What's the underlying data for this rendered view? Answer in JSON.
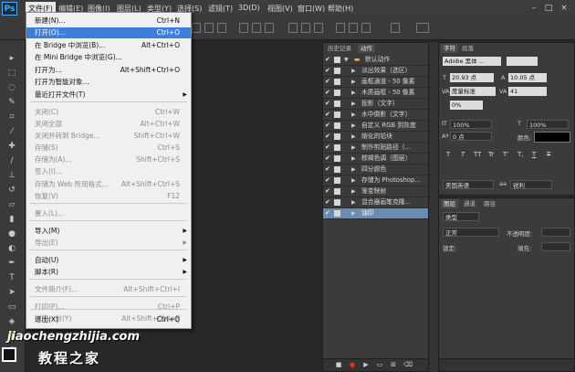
{
  "app": {
    "logo": "Ps"
  },
  "menubar": {
    "items": [
      "文件(F)",
      "编辑(E)",
      "图像(I)",
      "图层(L)",
      "类型(Y)",
      "选择(S)",
      "滤镜(T)",
      "3D(D)",
      "视图(V)",
      "窗口(W)",
      "帮助(H)"
    ],
    "window_controls": [
      "–",
      "□",
      "×"
    ]
  },
  "file_menu": {
    "items": [
      {
        "label": "新建(N)...",
        "shortcut": "Ctrl+N",
        "state": "normal"
      },
      {
        "label": "打开(O)...",
        "shortcut": "Ctrl+O",
        "state": "highlighted"
      },
      {
        "label": "在 Bridge 中浏览(B)...",
        "shortcut": "Alt+Ctrl+O",
        "state": "normal"
      },
      {
        "label": "在 Mini Bridge 中浏览(G)...",
        "shortcut": "",
        "state": "normal"
      },
      {
        "label": "打开为...",
        "shortcut": "Alt+Shift+Ctrl+O",
        "state": "normal"
      },
      {
        "label": "打开为智能对象...",
        "shortcut": "",
        "state": "normal"
      },
      {
        "label": "最近打开文件(T)",
        "shortcut": "",
        "state": "submenu"
      },
      {
        "label": "关闭(C)",
        "shortcut": "Ctrl+W",
        "state": "disabled"
      },
      {
        "label": "关闭全部",
        "shortcut": "Alt+Ctrl+W",
        "state": "disabled"
      },
      {
        "label": "关闭并转到 Bridge...",
        "shortcut": "Shift+Ctrl+W",
        "state": "disabled"
      },
      {
        "label": "存储(S)",
        "shortcut": "Ctrl+S",
        "state": "disabled"
      },
      {
        "label": "存储为(A)...",
        "shortcut": "Shift+Ctrl+S",
        "state": "disabled"
      },
      {
        "label": "签入(I)...",
        "shortcut": "",
        "state": "disabled"
      },
      {
        "label": "存储为 Web 所用格式...",
        "shortcut": "Alt+Shift+Ctrl+S",
        "state": "disabled"
      },
      {
        "label": "恢复(V)",
        "shortcut": "F12",
        "state": "disabled"
      },
      {
        "label": "置入(L)...",
        "shortcut": "",
        "state": "disabled"
      },
      {
        "label": "导入(M)",
        "shortcut": "",
        "state": "submenu"
      },
      {
        "label": "导出(E)",
        "shortcut": "",
        "state": "submenu-disabled"
      },
      {
        "label": "自动(U)",
        "shortcut": "",
        "state": "submenu"
      },
      {
        "label": "脚本(R)",
        "shortcut": "",
        "state": "submenu"
      },
      {
        "label": "文件简介(F)...",
        "shortcut": "Alt+Shift+Ctrl+I",
        "state": "disabled"
      },
      {
        "label": "打印(P)...",
        "shortcut": "Ctrl+P",
        "state": "disabled"
      },
      {
        "label": "打印一份(Y)",
        "shortcut": "Alt+Shift+Ctrl+P",
        "state": "disabled"
      },
      {
        "label": "退出(X)",
        "shortcut": "Ctrl+Q",
        "state": "normal"
      }
    ]
  },
  "actions_panel": {
    "tabs": [
      "历史记录",
      "动作"
    ],
    "active_tab": "动作",
    "set_name": "默认动作",
    "actions": [
      "淡出效果（选区）",
      "画框通道 - 50 像素",
      "木质画框 - 50 像素",
      "投影（文字）",
      "水中倒影（文字）",
      "自定义 RGB 到灰度",
      "熔化的铅块",
      "制作剪贴路径（...",
      "棕褐色调（图层）",
      "四分颜色",
      "存储为 Photoshop...",
      "渐变映射",
      "混合器画笔克隆...",
      "油印"
    ],
    "selected_action": "油印"
  },
  "character_panel": {
    "tabs": [
      "字符",
      "段落"
    ],
    "font_family": "Adobe 黑体 ...",
    "font_size": "20.93 点",
    "leading": "10.05 点",
    "kerning": "度量标准",
    "tracking": "41",
    "tsume": "0%",
    "vertical_scale": "100%",
    "horizontal_scale": "100%",
    "baseline_shift": "0 点",
    "color_label": "颜色:",
    "language": "美国英语",
    "anti_alias": "锐利",
    "style_buttons": [
      "T",
      "T",
      "TT",
      "Tr",
      "T'",
      "T,",
      "T",
      "T"
    ]
  },
  "layers_panel": {
    "tabs": [
      "图层",
      "通道",
      "路径"
    ],
    "kind_filter": "类型",
    "blend_mode": "正常",
    "opacity_label": "不透明度:",
    "lock_label": "锁定:",
    "fill_label": "填充:"
  },
  "watermark": {
    "url": "jiaochengzhijia.com",
    "name": "教程之家"
  },
  "colors": {
    "menu_highlight": "#3c7fd9",
    "selected_action": "#6b8bb0",
    "panel_bg": "#3b3b3b"
  }
}
